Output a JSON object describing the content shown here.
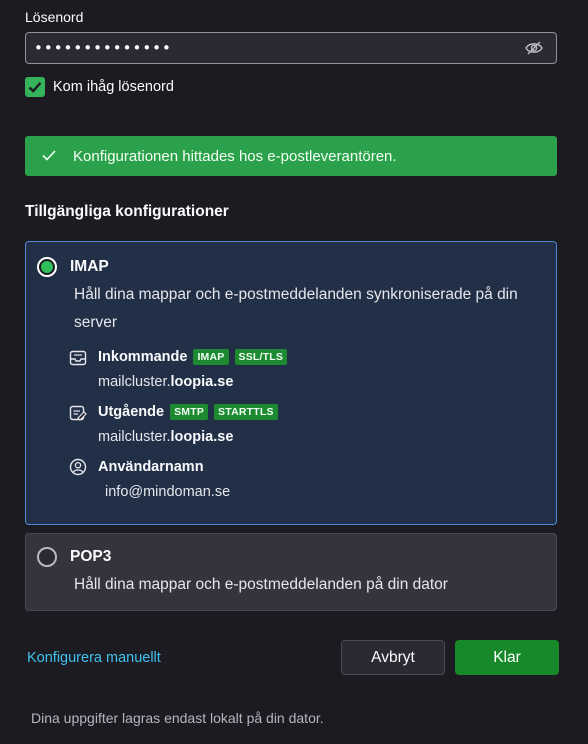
{
  "password": {
    "label": "Lösenord",
    "value": "••••••••••••••",
    "toggle_icon": "eye-slash-icon"
  },
  "remember": {
    "label": "Kom ihåg lösenord",
    "checked": true
  },
  "banner": {
    "icon": "checkmark-icon",
    "text": "Konfigurationen hittades hos e-postleverantören.",
    "color": "#2ca14b"
  },
  "configs": {
    "title": "Tillgängliga konfigurationer",
    "imap": {
      "name": "IMAP",
      "selected": true,
      "description": "Håll dina mappar och e-postmeddelanden synkroniserade på din server",
      "incoming": {
        "label": "Inkommande",
        "badges": [
          "IMAP",
          "SSL/TLS"
        ],
        "host_prefix": "mailcluster.",
        "host_domain": "loopia.se"
      },
      "outgoing": {
        "label": "Utgående",
        "badges": [
          "SMTP",
          "STARTTLS"
        ],
        "host_prefix": "mailcluster.",
        "host_domain": "loopia.se"
      },
      "username": {
        "label": "Användarnamn",
        "value": "info@mindoman.se"
      }
    },
    "pop3": {
      "name": "POP3",
      "selected": false,
      "description": "Håll dina mappar och e-postmeddelanden på din dator"
    }
  },
  "footer": {
    "manual_link": "Konfigurera manuellt",
    "cancel": "Avbryt",
    "done": "Klar",
    "note": "Dina uppgifter lagras endast lokalt på din dator."
  },
  "colors": {
    "accent": "#18892a",
    "link": "#3fc2ee",
    "selected_border": "#4a8ad6"
  }
}
